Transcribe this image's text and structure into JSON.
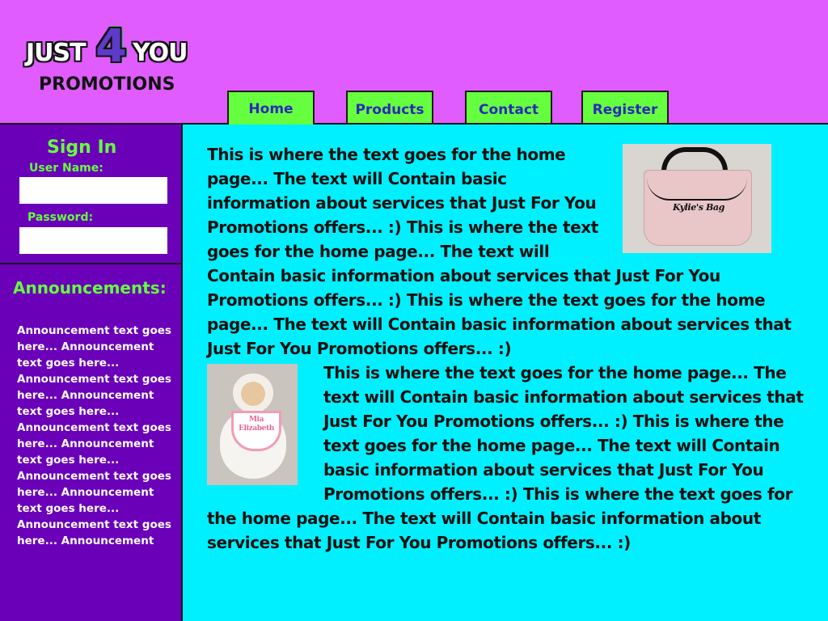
{
  "logo": {
    "just": "JUST",
    "four": "4",
    "you": "YOU",
    "promotions": "PROMOTIONS"
  },
  "nav": {
    "tabs": [
      {
        "label": "Home",
        "active": true
      },
      {
        "label": "Products"
      },
      {
        "label": "Contact"
      },
      {
        "label": "Register"
      }
    ]
  },
  "sidebar": {
    "signin_title": "Sign In",
    "username_label": "User Name:",
    "password_label": "Password:",
    "username_value": "",
    "password_value": "",
    "announcements_title": "Announcements:",
    "announcement_text": "Announcement text goes here... Announcement text goes here... Announcement text goes here... Announcement text goes here... Announcement text goes here... Announcement text goes here... Announcement text goes here... Announcement text goes here... Announcement text goes here... Announcement"
  },
  "main": {
    "paragraph1": "This is where the text goes for the home page... The text will Contain basic information about services that Just For You Promotions offers... :)   This is where the text goes for the home page... The text will Contain basic information about services that Just For You Promotions offers... :) This is where the text goes for the home page... The text will Contain basic information about services that Just For You Promotions offers... :)",
    "paragraph2": "This is where the text goes for the home page... The text will Contain basic information about services that Just For You Promotions offers... :) This is where the text goes for the home page... The text will Contain basic information about services that Just For You Promotions offers... :) This is where the text goes for the home page... The text will Contain basic information about services that Just For You Promotions offers... :)",
    "bag_caption": "Kylie's Bag",
    "lamb_caption": "Mia Elizabeth"
  },
  "colors": {
    "header_bg": "#E05CFF",
    "sidebar_bg": "#6A00B8",
    "main_bg": "#00F0FF",
    "accent_green": "#66FF3F",
    "tab_text": "#2A2AB8"
  }
}
